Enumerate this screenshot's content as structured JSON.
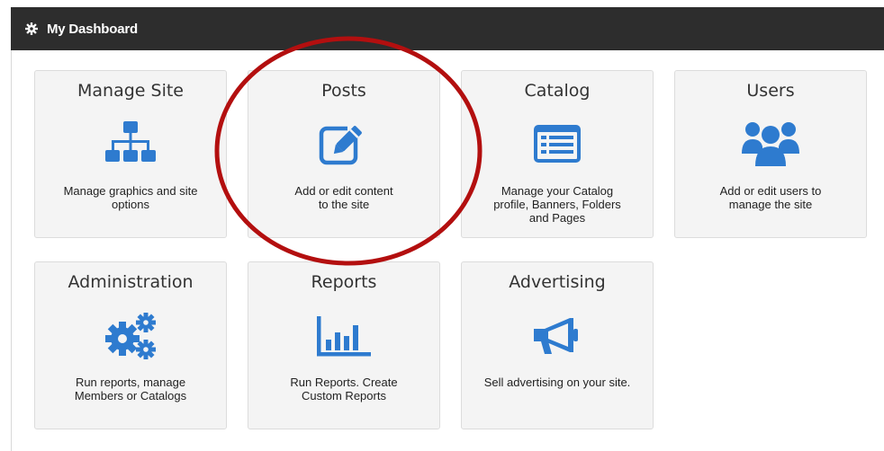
{
  "header": {
    "title": "My Dashboard",
    "icon": "gear-icon"
  },
  "accent_color": "#2e7bcf",
  "highlight_color": "#b30f0f",
  "tiles": [
    {
      "title": "Manage Site",
      "description": "Manage graphics and site\noptions",
      "icon": "sitemap-icon"
    },
    {
      "title": "Posts",
      "description": "Add or edit content\nto the site",
      "icon": "edit-icon"
    },
    {
      "title": "Catalog",
      "description": "Manage your Catalog\nprofile, Banners, Folders\nand Pages",
      "icon": "list-icon"
    },
    {
      "title": "Users",
      "description": "Add or edit users to\nmanage the site",
      "icon": "users-icon"
    },
    {
      "title": "Administration",
      "description": "Run reports, manage\nMembers or Catalogs",
      "icon": "gears-icon"
    },
    {
      "title": "Reports",
      "description": "Run Reports. Create\nCustom Reports",
      "icon": "bar-chart-icon"
    },
    {
      "title": "Advertising",
      "description": "Sell advertising on your site.",
      "icon": "bullhorn-icon"
    }
  ]
}
